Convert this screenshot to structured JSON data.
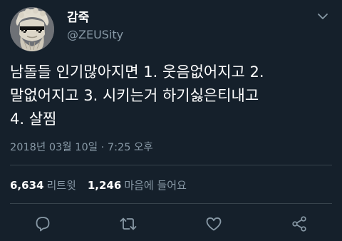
{
  "user": {
    "display_name": "감죽",
    "handle": "@ZEUSity"
  },
  "tweet": {
    "text": "남돌들 인기많아지면 1. 웃음없어지고 2.\n말없어지고 3. 시키는거 하기싫은티내고\n4. 살찜",
    "timestamp": "2018년 03월 10일 · 7:25 오후"
  },
  "stats": {
    "retweets_count": "6,634",
    "retweets_label": "리트윗",
    "likes_count": "1,246",
    "likes_label": "마음에 들어요"
  },
  "icons": {
    "menu": "chevron-down-icon",
    "reply": "reply-icon",
    "retweet": "retweet-icon",
    "like": "heart-icon",
    "share": "share-icon"
  },
  "colors": {
    "background": "#15202b",
    "text": "#ffffff",
    "secondary_text": "#8899a6",
    "divider": "#38444d"
  }
}
